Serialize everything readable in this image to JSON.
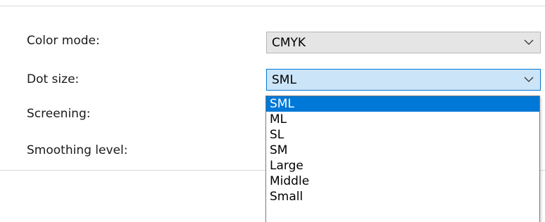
{
  "fields": {
    "color_mode": {
      "label": "Color mode:",
      "value": "CMYK"
    },
    "dot_size": {
      "label": "Dot size:",
      "value": "SML"
    },
    "screening": {
      "label": "Screening:"
    },
    "smoothing_level": {
      "label": "Smoothing level:"
    }
  },
  "dot_size_options": [
    "SML",
    "ML",
    "SL",
    "SM",
    "Large",
    "Middle",
    "Small"
  ],
  "colors": {
    "accent": "#0078d7",
    "focused_bg": "#cce4f7",
    "combo_bg": "#e5e5e5"
  },
  "icons": {
    "dropdown_arrow": "chevron-down-icon"
  }
}
